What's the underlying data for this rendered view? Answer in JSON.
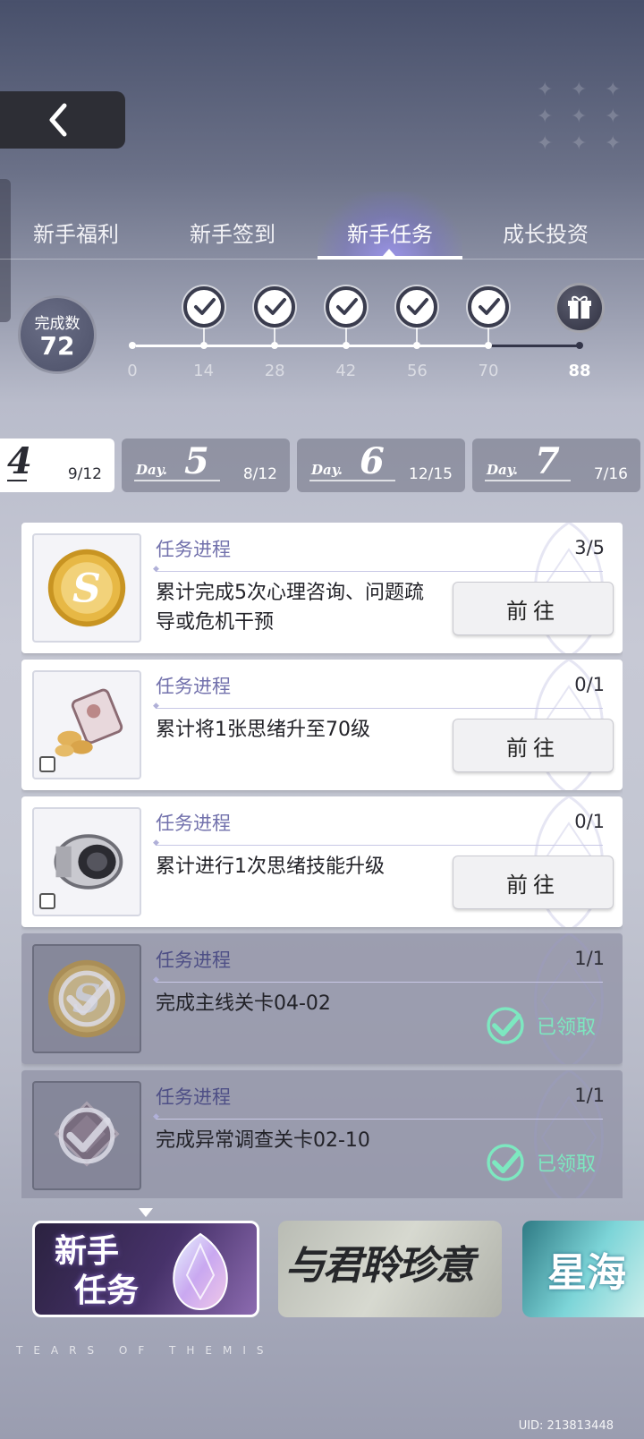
{
  "tabs": [
    {
      "label": "新手福利"
    },
    {
      "label": "新手签到"
    },
    {
      "label": "新手任务",
      "active": true
    },
    {
      "label": "成长投资"
    }
  ],
  "progress": {
    "completed_label": "完成数",
    "completed_count": "72",
    "current_value": 72,
    "milestones": [
      {
        "value": "0"
      },
      {
        "value": "14",
        "claimed": true
      },
      {
        "value": "28",
        "claimed": true
      },
      {
        "value": "42",
        "claimed": true
      },
      {
        "value": "56",
        "claimed": true
      },
      {
        "value": "70",
        "claimed": true
      },
      {
        "value": "88",
        "reward": "gift-icon"
      }
    ]
  },
  "days": [
    {
      "word": "",
      "num": "4",
      "frac": "9/12",
      "active": true
    },
    {
      "word": "Day.",
      "num": "5",
      "frac": "8/12"
    },
    {
      "word": "Day.",
      "num": "6",
      "frac": "12/15"
    },
    {
      "word": "Day.",
      "num": "7",
      "frac": "7/16"
    }
  ],
  "quests": [
    {
      "label": "任务进程",
      "frac": "3/5",
      "desc": "累计完成5次心理咨询、问题疏导或危机干预",
      "action": "前往",
      "icon": "coin-icon",
      "done": false
    },
    {
      "label": "任务进程",
      "frac": "0/1",
      "desc": "累计将1张思绪升至70级",
      "action": "前往",
      "icon": "snack-bag-icon",
      "done": false
    },
    {
      "label": "任务进程",
      "frac": "0/1",
      "desc": "累计进行1次思绪技能升级",
      "action": "前往",
      "icon": "lens-icon",
      "done": false
    },
    {
      "label": "任务进程",
      "frac": "1/1",
      "desc": "完成主线关卡04-02",
      "status": "已领取",
      "icon": "coin-icon",
      "done": true
    },
    {
      "label": "任务进程",
      "frac": "1/1",
      "desc": "完成异常调查关卡02-10",
      "status": "已领取",
      "icon": "badge-icon",
      "done": true
    }
  ],
  "banners": [
    {
      "title_line1": "新手",
      "title_line2": "任务"
    },
    {
      "title": "与君聆珍意"
    },
    {
      "title": "星海"
    }
  ],
  "brand": "TEARS OF THEMIS",
  "uid": "UID: 213813448",
  "colors": {
    "accent": "#7271ac",
    "claimed": "#7de8c0",
    "panel_dark": "#2d2e35"
  }
}
